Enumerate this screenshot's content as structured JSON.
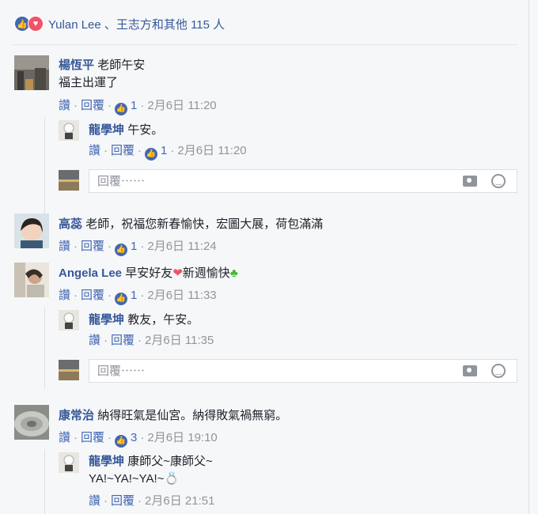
{
  "reactions": {
    "names": "Yulan Lee",
    "others": "、王志方和其他 115 人"
  },
  "actions": {
    "like": "讚",
    "reply": "回覆",
    "sep": "·"
  },
  "reply_placeholder": "回覆⋯⋯",
  "comments": [
    {
      "name": "楊恆平",
      "text": "老師午安",
      "text2": "福主出運了",
      "likes": "1",
      "time": "2月6日 11:20",
      "replies": [
        {
          "name": "龍學坤",
          "text": "午安。",
          "likes": "1",
          "time": "2月6日 11:20"
        }
      ]
    },
    {
      "name": "高蕊",
      "text": "老師，祝福您新春愉快，宏圖大展，荷包滿滿",
      "likes": "1",
      "time": "2月6日 11:24"
    },
    {
      "name": "Angela Lee",
      "text": "早安好友",
      "text_after": "新週愉快",
      "likes": "1",
      "time": "2月6日 11:33",
      "replies": [
        {
          "name": "龍學坤",
          "text": "教友，午安。",
          "time": "2月6日 11:35"
        }
      ]
    },
    {
      "name": "康常治",
      "text": "納得旺氣是仙宮。納得敗氣禍無窮。",
      "likes": "3",
      "time": "2月6日 19:10",
      "replies": [
        {
          "name": "龍學坤",
          "text": "康師父~康師父~",
          "text2": "YA!~YA!~YA!~",
          "time": "2月6日 21:51"
        }
      ]
    }
  ],
  "colors": {
    "link": "#365899",
    "action": "#4267b2",
    "meta": "#90949c",
    "heart": "#f25268"
  },
  "icons": [
    "like-reaction-icon",
    "love-reaction-icon",
    "camera-icon",
    "emoji-icon",
    "heart-emoji-icon",
    "sprout-emoji-icon",
    "ring-emoji-icon"
  ]
}
